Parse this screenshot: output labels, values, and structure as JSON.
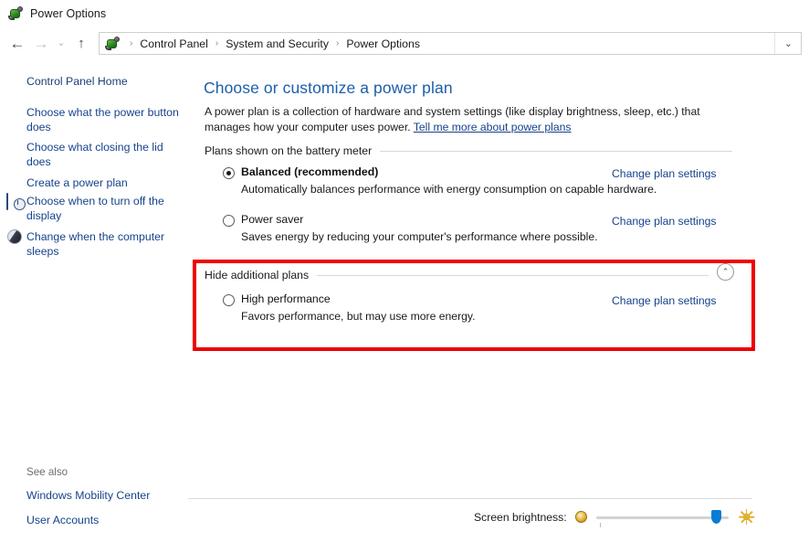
{
  "window": {
    "title": "Power Options",
    "icon": "power-plug-icon"
  },
  "nav": {
    "back_icon": "←",
    "forward_icon": "→",
    "recent_icon": "⌄",
    "up_icon": "↑",
    "address_chevron_icon": "⌄",
    "breadcrumbs": [
      {
        "label": "Control Panel"
      },
      {
        "label": "System and Security"
      },
      {
        "label": "Power Options"
      }
    ],
    "separator": "›"
  },
  "sidebar": {
    "home_label": "Control Panel Home",
    "items": [
      {
        "label": "Choose what the power button does",
        "icon": null
      },
      {
        "label": "Choose what closing the lid does",
        "icon": null
      },
      {
        "label": "Create a power plan",
        "icon": null
      },
      {
        "label": "Choose when to turn off the display",
        "icon": "display-icon"
      },
      {
        "label": "Change when the computer sleeps",
        "icon": "sleep-moon-icon"
      }
    ],
    "see_also_title": "See also",
    "see_also": [
      {
        "label": "Windows Mobility Center"
      },
      {
        "label": "User Accounts"
      }
    ]
  },
  "main": {
    "title": "Choose or customize a power plan",
    "intro_text": "A power plan is a collection of hardware and system settings (like display brightness, sleep, etc.) that manages how your computer uses power. ",
    "intro_link": "Tell me more about power plans",
    "section_battery_label": "Plans shown on the battery meter",
    "section_additional_label": "Hide additional plans",
    "collapse_icon": "⌃",
    "change_link_label": "Change plan settings",
    "plans": [
      {
        "name": "Balanced (recommended)",
        "description": "Automatically balances performance with energy consumption on capable hardware.",
        "selected": true,
        "bold": true,
        "change_label": "Change plan settings"
      },
      {
        "name": "Power saver",
        "description": "Saves energy by reducing your computer's performance where possible.",
        "selected": false,
        "bold": false,
        "change_label": "Change plan settings"
      }
    ],
    "additional_plans": [
      {
        "name": "High performance",
        "description": "Favors performance, but may use more energy.",
        "selected": false,
        "bold": false,
        "change_label": "Change plan settings"
      }
    ]
  },
  "brightness": {
    "label": "Screen brightness:",
    "low_icon": "dim-bulb-icon",
    "high_icon": "bright-sun-icon",
    "value_percent": 94
  },
  "colors": {
    "accent_link": "#15428b",
    "title_blue": "#1b5faa",
    "highlight_box": "#ee0000",
    "slider_thumb": "#0a7cd4"
  }
}
